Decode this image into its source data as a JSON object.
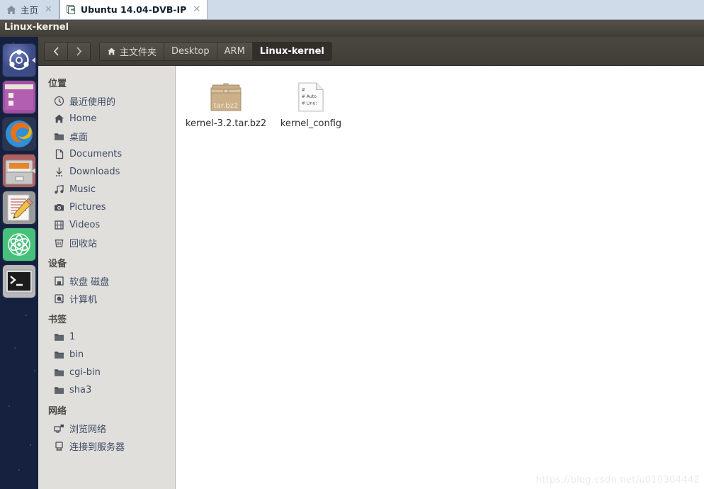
{
  "vm_tabs": [
    {
      "label": "主页",
      "icon": "home-icon",
      "active": false,
      "close": "✕"
    },
    {
      "label": "Ubuntu 14.04-DVB-IP",
      "icon": "virtual-machine-icon",
      "active": true,
      "close": "✕"
    }
  ],
  "window": {
    "title": "Linux-kernel"
  },
  "launcher": {
    "items": [
      {
        "name": "ubuntu-dash-icon",
        "label": "Ubuntu Dash"
      },
      {
        "name": "files-nautilus-icon",
        "label": "Files"
      },
      {
        "name": "firefox-icon",
        "label": "Firefox"
      },
      {
        "name": "file-cabinet-icon",
        "label": "Archive Manager"
      },
      {
        "name": "text-editor-icon",
        "label": "Text Editor"
      },
      {
        "name": "atom-editor-icon",
        "label": "Atom"
      },
      {
        "name": "terminal-icon",
        "label": "Terminal"
      }
    ]
  },
  "toolbar": {
    "back_label": "Back",
    "forward_label": "Forward",
    "breadcrumbs": [
      {
        "label": "主文件夹",
        "icon": "home-icon",
        "current": false
      },
      {
        "label": "Desktop",
        "icon": "",
        "current": false
      },
      {
        "label": "ARM",
        "icon": "",
        "current": false
      },
      {
        "label": "Linux-kernel",
        "icon": "",
        "current": true
      }
    ]
  },
  "sidebar": {
    "sections": [
      {
        "title": "位置",
        "items": [
          {
            "label": "最近使用的",
            "icon": "recent-clock-icon"
          },
          {
            "label": "Home",
            "icon": "home-icon"
          },
          {
            "label": "桌面",
            "icon": "folder-icon"
          },
          {
            "label": "Documents",
            "icon": "document-icon"
          },
          {
            "label": "Downloads",
            "icon": "download-icon"
          },
          {
            "label": "Music",
            "icon": "music-note-icon"
          },
          {
            "label": "Pictures",
            "icon": "camera-icon"
          },
          {
            "label": "Videos",
            "icon": "film-icon"
          },
          {
            "label": "回收站",
            "icon": "trash-icon"
          }
        ]
      },
      {
        "title": "设备",
        "items": [
          {
            "label": "软盘 磁盘",
            "icon": "floppy-disk-icon"
          },
          {
            "label": "计算机",
            "icon": "computer-icon"
          }
        ]
      },
      {
        "title": "书签",
        "items": [
          {
            "label": "1",
            "icon": "folder-icon"
          },
          {
            "label": "bin",
            "icon": "folder-icon"
          },
          {
            "label": "cgi-bin",
            "icon": "folder-icon"
          },
          {
            "label": "sha3",
            "icon": "folder-icon"
          }
        ]
      },
      {
        "title": "网络",
        "items": [
          {
            "label": "浏览网络",
            "icon": "network-browse-icon"
          },
          {
            "label": "连接到服务器",
            "icon": "server-connect-icon"
          }
        ]
      }
    ]
  },
  "content": {
    "files": [
      {
        "name": "kernel-3.2.tar.bz2",
        "type": "archive",
        "badge": "tar.bz2",
        "icon": "archive-box-icon"
      },
      {
        "name": "kernel_config",
        "type": "text",
        "icon": "text-file-icon",
        "preview_lines": [
          "#",
          "# Auto",
          "# Linu:"
        ]
      }
    ]
  },
  "watermark": {
    "text": "https://blog.csdn.net/u010304442"
  },
  "colors": {
    "tabstrip": "#cfdbe8",
    "titlebar": "#48453f",
    "toolbar": "#403d37",
    "sidebar": "#e0dfdc",
    "content": "#ffffff",
    "launcher": "#15213f",
    "crumb_active": "#322f2b",
    "sidebar_text": "#3f4c63"
  }
}
